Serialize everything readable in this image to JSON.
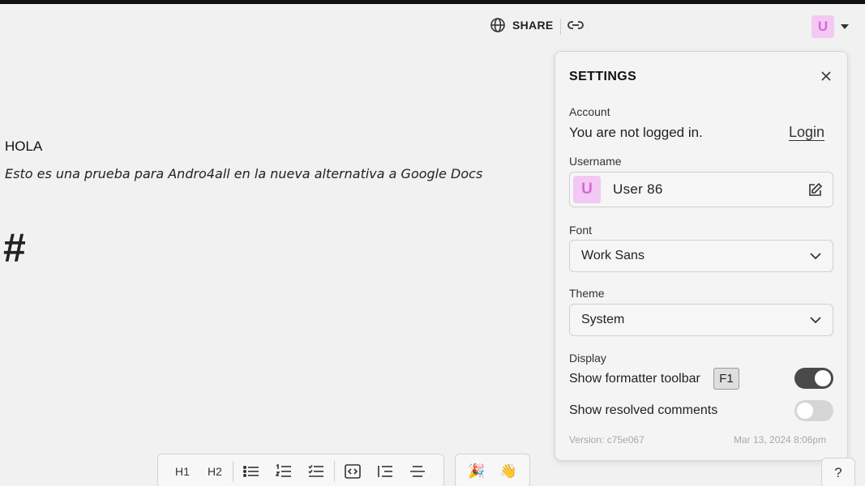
{
  "topbar": {
    "share_label": "SHARE",
    "share_icon": "globe-icon",
    "link_icon": "link-icon",
    "user_initial": "U",
    "user_avatar_bg": "#f3c8f3",
    "user_avatar_fg": "#d46ad8"
  },
  "document": {
    "heading": "HOLA",
    "paragraph": "Esto es una prueba para Andro4all en la nueva alternativa a Google Docs",
    "hash": "#"
  },
  "settings": {
    "title": "SETTINGS",
    "account_label": "Account",
    "not_logged_text": "You are not logged in.",
    "login_label": "Login",
    "username_label": "Username",
    "username_initial": "U",
    "username_value": "User 86",
    "font_label": "Font",
    "font_value": "Work Sans",
    "theme_label": "Theme",
    "theme_value": "System",
    "display_label": "Display",
    "show_toolbar_label": "Show formatter toolbar",
    "show_toolbar_key": "F1",
    "show_toolbar_on": true,
    "show_resolved_label": "Show resolved comments",
    "show_resolved_on": false,
    "version": "Version: c75e067",
    "date": "Mar 13, 2024 8:06pm"
  },
  "toolbar": {
    "h1": "H1",
    "h2": "H2",
    "icons": [
      "bullet-list-icon",
      "numbered-list-icon",
      "checklist-icon",
      "code-block-icon",
      "indent-icon",
      "strikethrough-icon"
    ],
    "emoji_party": "🎉",
    "emoji_wave": "👋",
    "help": "?"
  },
  "colors": {
    "background": "#f1f1f1",
    "toggle_on": "#4a4a4a",
    "toggle_off": "#d5d5d5"
  }
}
